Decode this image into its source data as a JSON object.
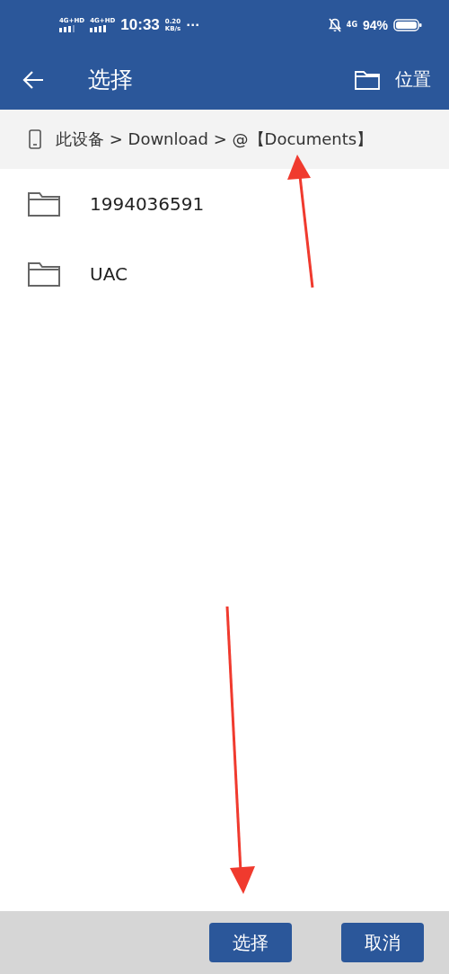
{
  "status_bar": {
    "signal_1": "4G+HD",
    "signal_2": "4G+HD",
    "time": "10:33",
    "speed_value": "0.20",
    "speed_unit": "KB/s",
    "more": "···",
    "network": "4G",
    "battery": "94%"
  },
  "header": {
    "title": "选择",
    "location_label": "位置"
  },
  "breadcrumb": {
    "path": "此设备 > Download > @【Documents】"
  },
  "folders": [
    {
      "name": "1994036591"
    },
    {
      "name": "UAC"
    }
  ],
  "buttons": [
    {
      "label": "选择"
    },
    {
      "label": "取消"
    }
  ]
}
